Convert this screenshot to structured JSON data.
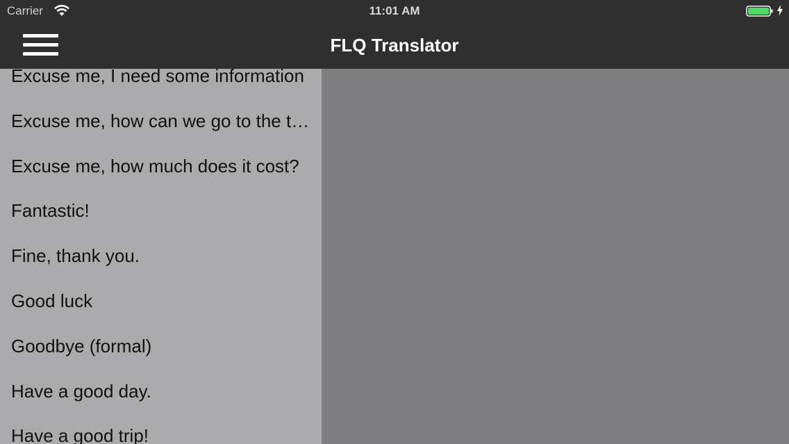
{
  "status_bar": {
    "carrier": "Carrier",
    "time": "11:01 AM",
    "battery_color": "#4cd964"
  },
  "nav_bar": {
    "title": "FLQ Translator",
    "menu_icon": "hamburger-menu-icon"
  },
  "phrases": [
    "Excuse me, I need some information",
    "Excuse me, how can we go to the train station?",
    "Excuse me, how much does it cost?",
    "Fantastic!",
    "Fine, thank you.",
    "Good luck",
    "Goodbye (formal)",
    "Have a good day.",
    "Have a good trip!"
  ]
}
